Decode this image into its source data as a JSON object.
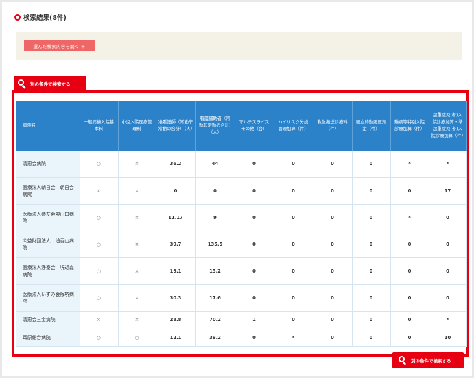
{
  "heading": "検索結果(8件)",
  "open_conditions_button": "選んだ検索内容を開く ＋",
  "other_conditions_button": "別の条件で検索する",
  "table": {
    "headers": [
      "病院名",
      "一般病棟入院基本料",
      "小児入院医療管理料",
      "准看護師（常勤非常勤の合計）（人）",
      "看護補助者（常勤非常勤の合計）（人）",
      "マルチスライス　その他（台）",
      "ハイリスク分娩管理加算（件）",
      "救急搬送診療料（件）",
      "観血的動脈圧測定（件）",
      "難病等特別入院診療加算（件）",
      "超重症児(者)入院診療加算・準超重症児(者)入院診療加算（件）"
    ],
    "rows": [
      [
        "清恵会病院",
        "○",
        "×",
        "36.2",
        "44",
        "0",
        "0",
        "0",
        "0",
        "*",
        "*"
      ],
      [
        "医療法人朝日会　朝日会病院",
        "×",
        "×",
        "0",
        "0",
        "0",
        "0",
        "0",
        "0",
        "0",
        "17"
      ],
      [
        "医療法人恭友会堺山口病院",
        "○",
        "×",
        "11.17",
        "9",
        "0",
        "0",
        "0",
        "0",
        "*",
        "0"
      ],
      [
        "公益財団法人　浅香山病院",
        "○",
        "×",
        "39.7",
        "135.5",
        "0",
        "0",
        "0",
        "0",
        "0",
        "0"
      ],
      [
        "医療法人浄寮会　堺近森病院",
        "○",
        "×",
        "19.1",
        "15.2",
        "0",
        "0",
        "0",
        "0",
        "0",
        "0"
      ],
      [
        "医療法人いずみ会阪堺病院",
        "○",
        "×",
        "30.3",
        "17.6",
        "0",
        "0",
        "0",
        "0",
        "0",
        "0"
      ],
      [
        "清恵会三宝病院",
        "×",
        "×",
        "28.8",
        "70.2",
        "1",
        "0",
        "0",
        "0",
        "0",
        "*"
      ],
      [
        "耳原総合病院",
        "○",
        "○",
        "12.1",
        "39.2",
        "0",
        "*",
        "0",
        "0",
        "0",
        "10"
      ]
    ]
  },
  "colors": {
    "accent_red": "#e60012",
    "header_blue": "#2b82c9",
    "name_cell_bg": "#eaf4fb"
  }
}
